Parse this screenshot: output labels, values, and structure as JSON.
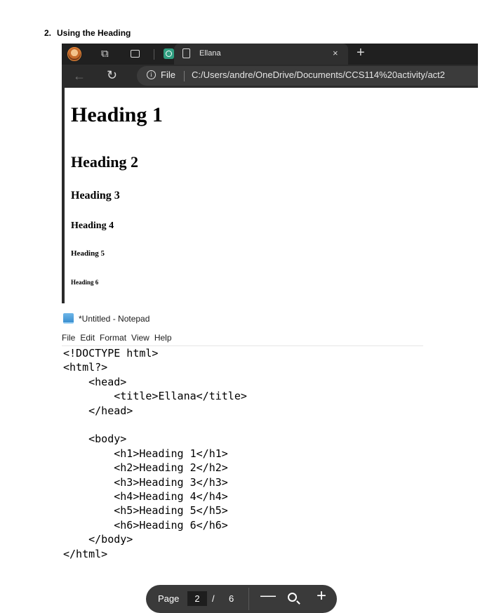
{
  "step": {
    "number": "2.",
    "title": "Using the Heading"
  },
  "browser": {
    "tab_title": "Ellana",
    "tab_close": "×",
    "new_tab": "+",
    "address": {
      "scheme_label": "File",
      "url": "C:/Users/andre/OneDrive/Documents/CCS114%20activity/act2"
    },
    "headings": [
      "Heading 1",
      "Heading 2",
      "Heading 3",
      "Heading 4",
      "Heading 5",
      "Heading 6"
    ]
  },
  "notepad": {
    "title": "*Untitled - Notepad",
    "menu": [
      "File",
      "Edit",
      "Format",
      "View",
      "Help"
    ],
    "code": "<!DOCTYPE html>\n<html?>\n    <head>\n        <title>Ellana</title>\n    </head>\n\n    <body>\n        <h1>Heading 1</h1>\n        <h2>Heading 2</h2>\n        <h3>Heading 3</h3>\n        <h4>Heading 4</h4>\n        <h5>Heading 5</h5>\n        <h6>Heading 6</h6>\n    </body>\n</html>"
  },
  "pdf_toolbar": {
    "page_label": "Page",
    "current_page": "2",
    "separator": "/",
    "total_pages": "6",
    "zoom_out_label": "—",
    "zoom_in_label": "+"
  },
  "icons": {
    "profile": "avatar-icon",
    "workspaces": "workspaces-icon",
    "tab_actions": "tab-actions-icon",
    "pinned_tab": "chatgpt-icon",
    "page": "document-icon",
    "back": "back-arrow-icon",
    "reload": "reload-icon",
    "site_info": "info-icon",
    "notepad": "notepad-icon",
    "zoom": "zoom-icon"
  },
  "colors": {
    "browser_chrome": "#202020",
    "address_bar": "#2b2b2b",
    "pdf_toolbar": "#3a3a3a",
    "chatgpt_icon": "#2f9e80"
  }
}
